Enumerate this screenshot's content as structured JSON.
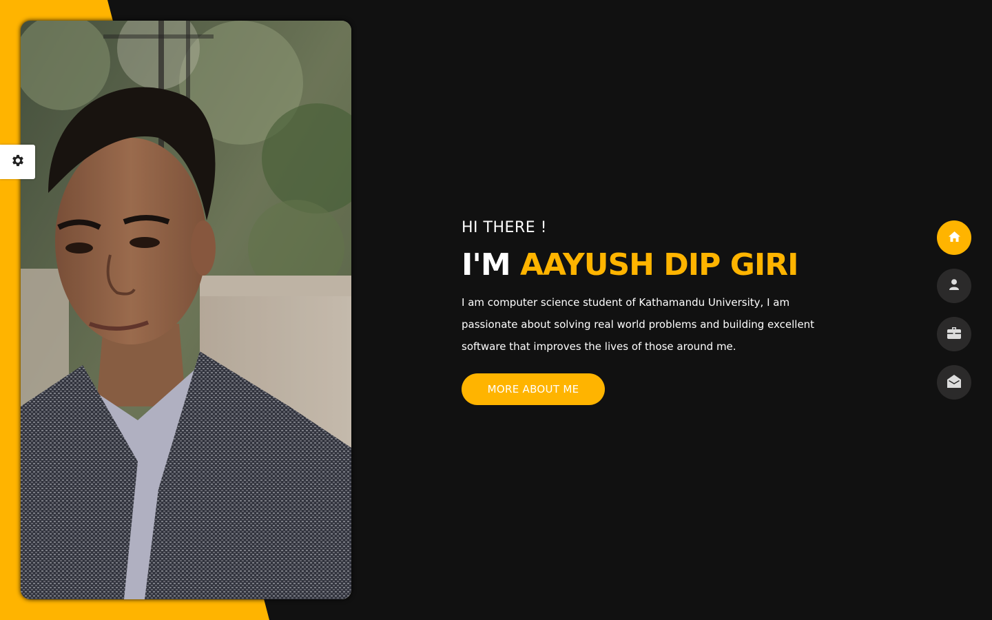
{
  "hero": {
    "greeting": "HI THERE !",
    "im_prefix": "I'M ",
    "name": "AAYUSH DIP GIRI",
    "description": "I am computer science student of Kathamandu University, I am passionate about solving real world problems and building excellent software that improves the lives of those around me.",
    "cta_label": "MORE ABOUT ME"
  },
  "colors": {
    "accent": "#ffb400",
    "background": "#111111",
    "nav_inactive": "#2b2a2a",
    "text": "#ffffff"
  },
  "nav": [
    {
      "icon": "home-icon",
      "active": true
    },
    {
      "icon": "user-icon",
      "active": false
    },
    {
      "icon": "briefcase-icon",
      "active": false
    },
    {
      "icon": "envelope-open-icon",
      "active": false
    }
  ],
  "settings": {
    "icon": "gear-icon"
  },
  "portrait": {
    "icon": "portrait-photo"
  }
}
